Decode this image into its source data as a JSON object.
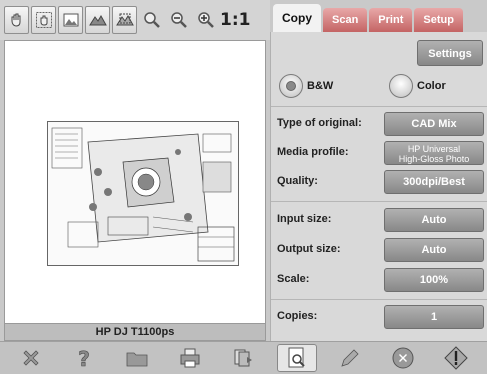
{
  "toolbar": {
    "icons": [
      "hand-tool-icon",
      "hand-select-icon",
      "image-fit-icon",
      "mountains-icon",
      "mountains-select-icon",
      "zoom-fit-icon",
      "zoom-out-icon",
      "zoom-in-icon"
    ],
    "ratio_label": "1:1"
  },
  "preview": {
    "device_name": "HP DJ T1100ps"
  },
  "tabs": [
    {
      "label": "Copy",
      "active": true
    },
    {
      "label": "Scan",
      "active": false
    },
    {
      "label": "Print",
      "active": false
    },
    {
      "label": "Setup",
      "active": false
    }
  ],
  "panel": {
    "settings_label": "Settings",
    "color_mode": {
      "bw_label": "B&W",
      "color_label": "Color",
      "selected": "B&W"
    },
    "rows": [
      {
        "label": "Type of original:",
        "value": "CAD Mix"
      },
      {
        "label": "Media profile:",
        "value_line1": "HP Universal",
        "value_line2": "High-Gloss Photo"
      },
      {
        "label": "Quality:",
        "value": "300dpi/Best"
      },
      {
        "label": "Input size:",
        "value": "Auto"
      },
      {
        "label": "Output size:",
        "value": "Auto"
      },
      {
        "label": "Scale:",
        "value": "100%"
      },
      {
        "label": "Copies:",
        "value": "1"
      }
    ]
  },
  "bottombar": {
    "icons": [
      "cancel-icon",
      "help-icon",
      "folder-icon",
      "printer-icon",
      "print-queue-icon",
      "preview-icon",
      "pencil-icon",
      "stop-icon",
      "start-icon"
    ]
  },
  "colors": {
    "tab_inactive": "#c46464",
    "button_gray": "#999999",
    "panel_bg": "#d9d9d9"
  }
}
